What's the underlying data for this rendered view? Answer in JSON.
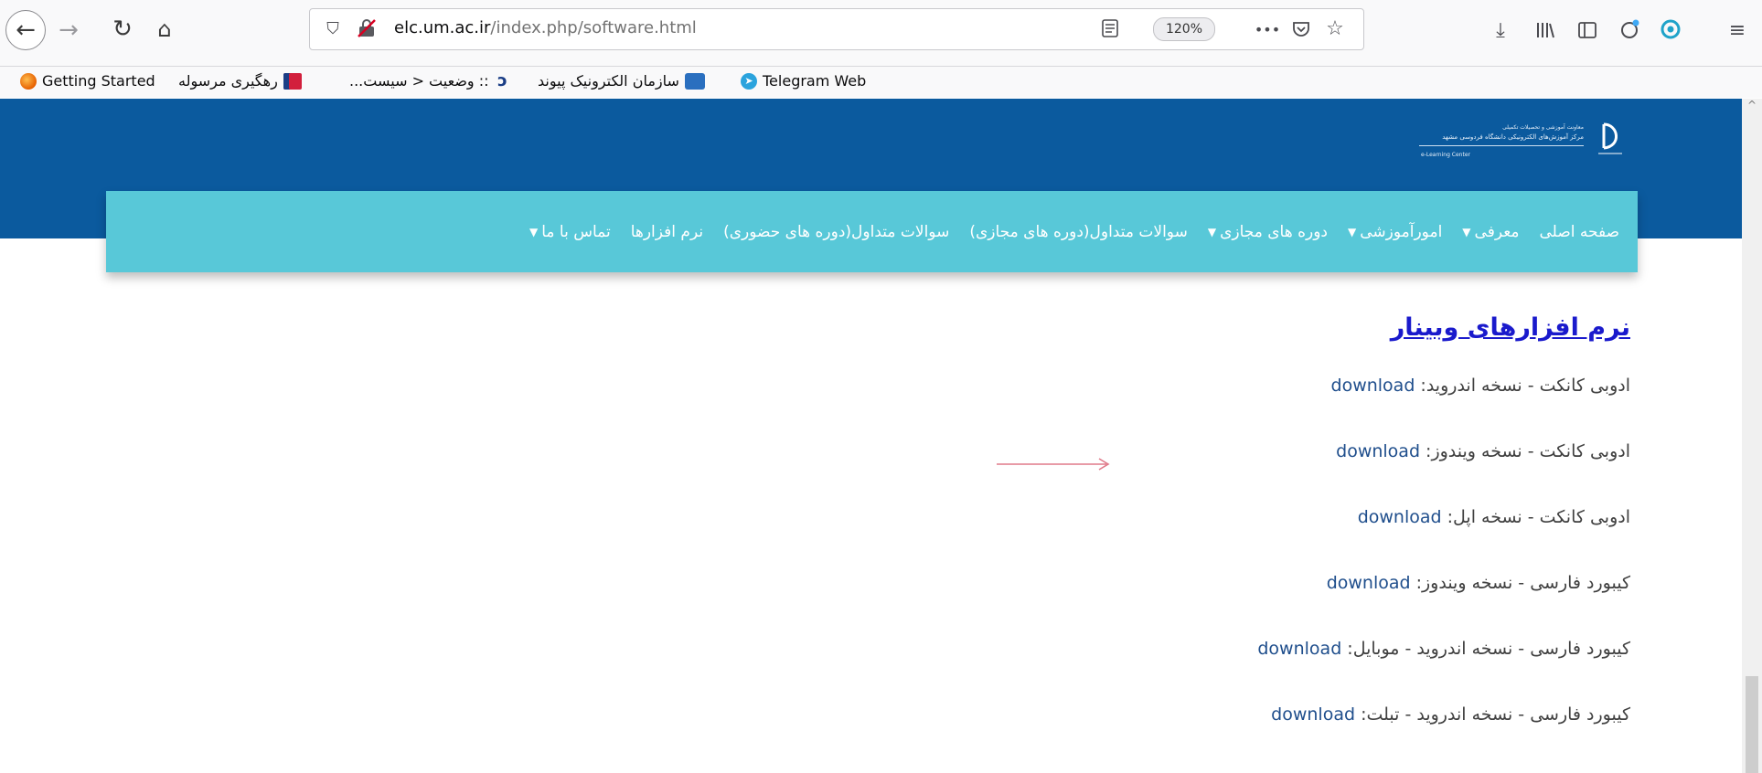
{
  "browser": {
    "url_host": "elc.um.ac.ir",
    "url_path": "/index.php/software.html",
    "zoom": "120%",
    "more_label": "•••"
  },
  "bookmarks": [
    {
      "label": "Getting Started",
      "color": "#e66000"
    },
    {
      "label": "رهگیری مرسوله",
      "color": "#d21f3c"
    },
    {
      "label": ":: وضعیت < سیست...",
      "color": "#1b3e86"
    },
    {
      "label": "سازمان الکترونیک پیوند",
      "color": "#2a6fbf"
    },
    {
      "label": "Telegram Web",
      "color": "#2aa3dd"
    }
  ],
  "menu": [
    {
      "label": "صفحه اصلی",
      "dropdown": false
    },
    {
      "label": "معرفی",
      "dropdown": true
    },
    {
      "label": "امورآموزشی",
      "dropdown": true
    },
    {
      "label": "دوره های مجازی",
      "dropdown": true
    },
    {
      "label": "سوالات متداول(دوره های مجازی)",
      "dropdown": false
    },
    {
      "label": "سوالات متداول(دوره های حضوری)",
      "dropdown": false
    },
    {
      "label": "نرم افزارها",
      "dropdown": false
    },
    {
      "label": "تماس با ما",
      "dropdown": true
    }
  ],
  "content": {
    "title": "نرم افزارهای وبینار",
    "rows": [
      {
        "text": "ادوبی کانکت - نسخه اندروید: ",
        "link": "download"
      },
      {
        "text": "ادوبی کانکت - نسخه ویندوز: ",
        "link": "download"
      },
      {
        "text": "ادوبی کانکت - نسخه اپل: ",
        "link": "download"
      },
      {
        "text": "کیبورد فارسی - نسخه ویندوز:  ",
        "link": "download"
      },
      {
        "text": "کیبورد فارسی - نسخه اندروید - موبایل:  ",
        "link": "download"
      },
      {
        "text": "کیبورد فارسی - نسخه اندروید - تبلت:  ",
        "link": "download"
      }
    ]
  },
  "colors": {
    "header": "#0b5a9e",
    "menu": "#58c8d8",
    "title": "#1a1acc",
    "link": "#1f4e8c",
    "arrow": "#e07a8a"
  }
}
